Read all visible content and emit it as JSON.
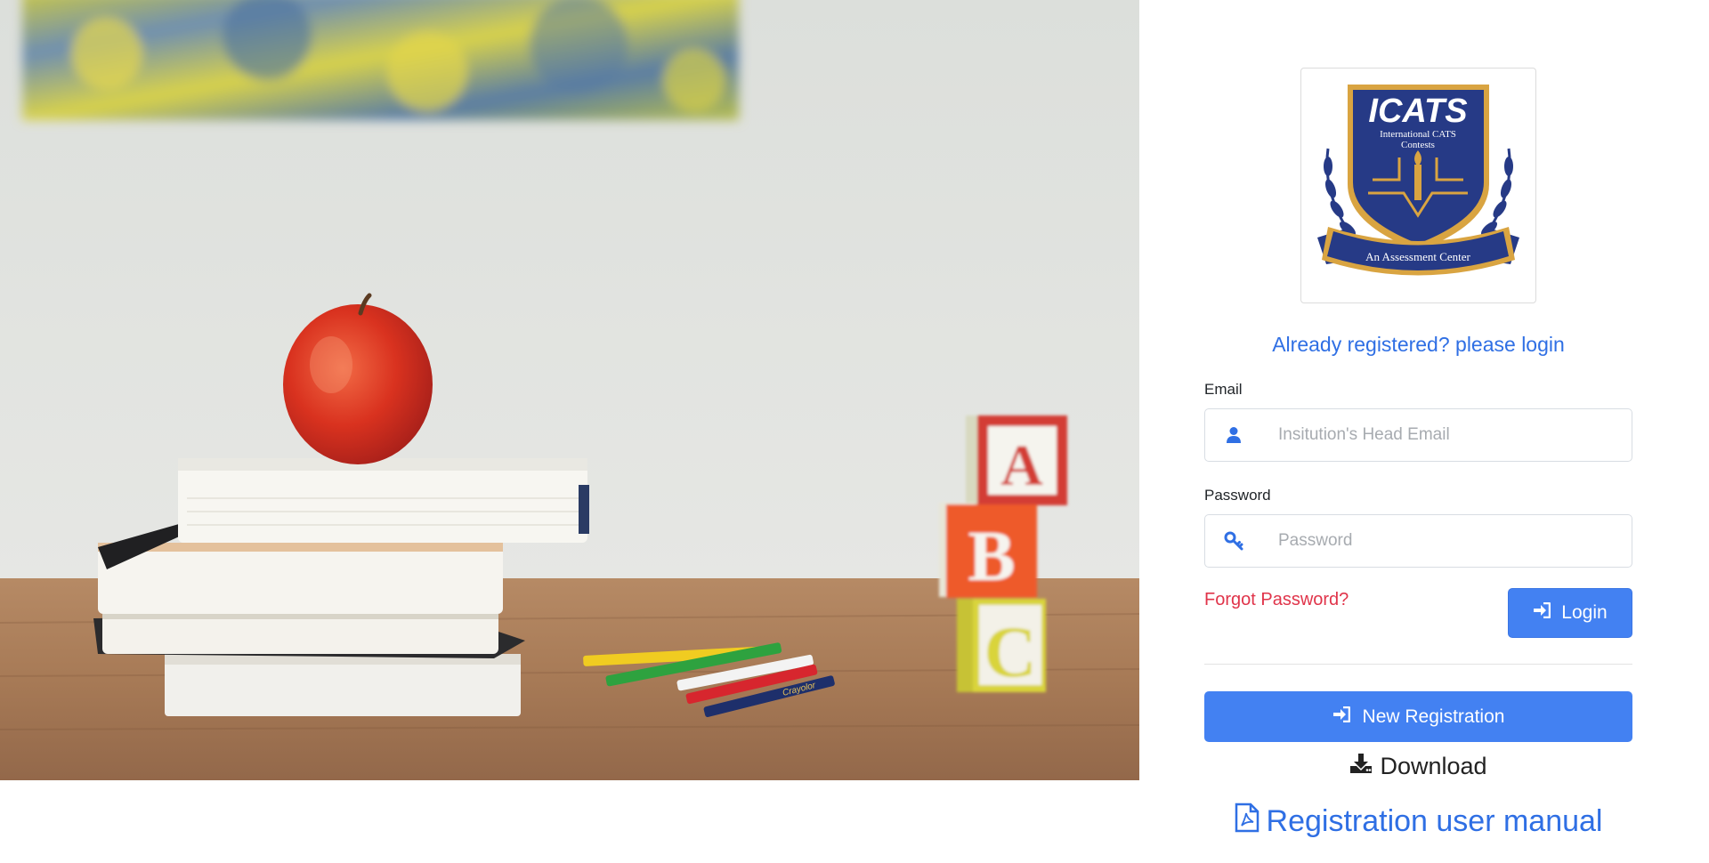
{
  "hero": {
    "blocks": [
      "A",
      "B",
      "C"
    ],
    "pencil_brand": "Crayolor"
  },
  "logo": {
    "title": "ICATS",
    "subtitle_line1": "International CATS",
    "subtitle_line2": "Contests",
    "ribbon": "An Assessment Center"
  },
  "login": {
    "heading": "Already registered? please login",
    "email_label": "Email",
    "email_placeholder": "Insitution's Head Email",
    "password_label": "Password",
    "password_placeholder": "Password",
    "forgot_label": "Forgot Password?",
    "login_button": "Login",
    "new_registration_button": "New Registration",
    "download_label": "Download",
    "manual_label": "Registration user manual"
  },
  "colors": {
    "primary": "#4381f2",
    "link": "#2f6fe4",
    "danger": "#e0344a",
    "shield_navy": "#263a86",
    "shield_gold": "#d9a441"
  },
  "icons": {
    "email": "user-icon",
    "password": "key-icon",
    "login": "sign-in-icon",
    "new_registration": "sign-in-icon",
    "download": "download-icon",
    "manual": "file-pdf-icon"
  }
}
